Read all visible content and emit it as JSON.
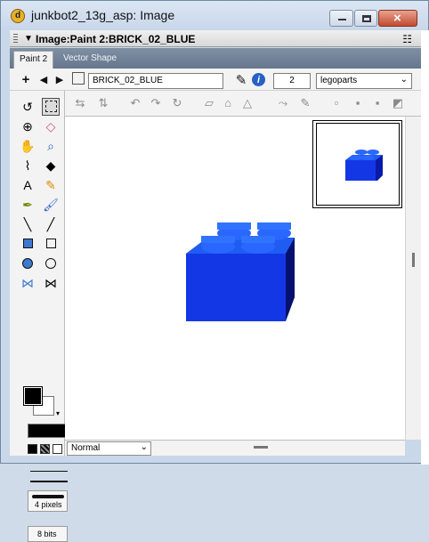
{
  "window": {
    "title": "junkbot2_13g_asp: Image",
    "panel_title": "Image:Paint 2:BRICK_02_BLUE",
    "app_icon_letter": "d"
  },
  "tabs": [
    {
      "label": "Paint 2"
    },
    {
      "label": "Vector Shape"
    }
  ],
  "toolbar": {
    "member_name": "BRICK_02_BLUE",
    "cast_number": "2",
    "cast_name": "legoparts"
  },
  "tool_panel": {
    "line_width": "4 pixels",
    "color_depth": "8 bits"
  },
  "status": {
    "ink": "Normal"
  },
  "colors": {
    "brick_face": "#1437e6",
    "brick_side": "#0a1aa8",
    "brick_top": "#1e5cf2",
    "brick_dark": "#06106e",
    "brick_studs": "#2a67ff"
  }
}
